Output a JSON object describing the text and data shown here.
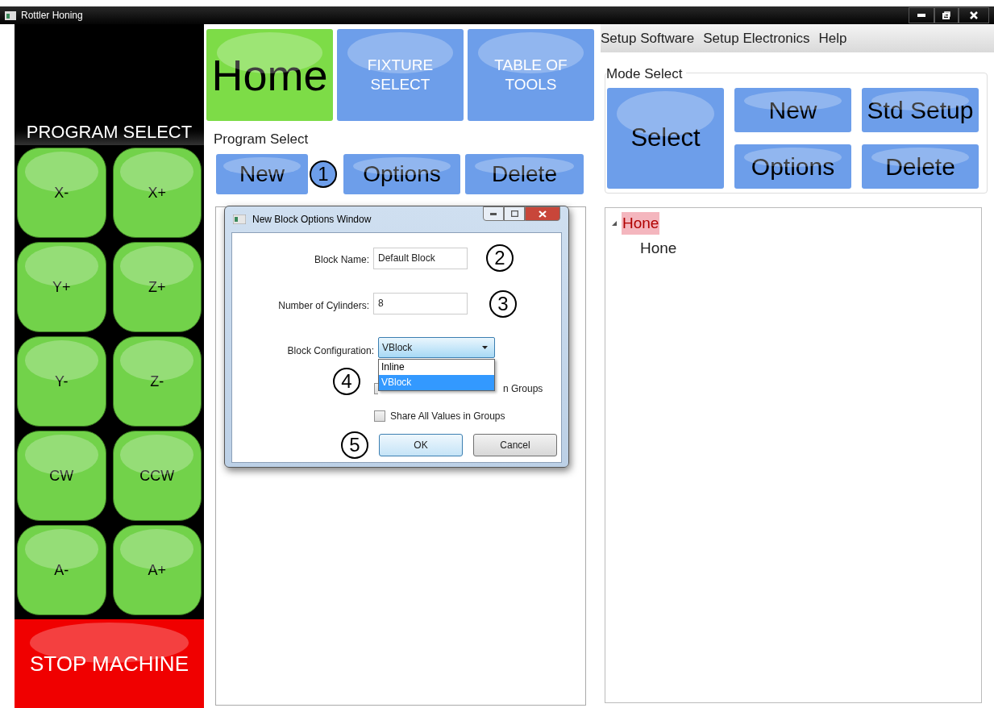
{
  "window": {
    "title": "Rottler Honing"
  },
  "left_panel": {
    "title": "PROGRAM SELECT",
    "jog_buttons": [
      "X-",
      "X+",
      "Y+",
      "Z+",
      "Y-",
      "Z-",
      "CW",
      "CCW",
      "A-",
      "A+"
    ],
    "stop_button": "STOP MACHINE"
  },
  "tabs": [
    {
      "label": "Home",
      "selected": true
    },
    {
      "label": "FIXTURE SELECT",
      "selected": false
    },
    {
      "label": "TABLE OF TOOLS",
      "selected": false
    }
  ],
  "program_select": {
    "label": "Program Select",
    "buttons": [
      {
        "label": "New",
        "callout": "1"
      },
      {
        "label": "Options"
      },
      {
        "label": "Delete"
      }
    ]
  },
  "dialog": {
    "title": "New Block Options Window",
    "block_name": {
      "label": "Block Name:",
      "value": "Default Block",
      "callout": "2"
    },
    "cylinders": {
      "label": "Number of Cylinders:",
      "value": "8",
      "callout": "3"
    },
    "block_configuration": {
      "label": "Block Configuration:",
      "value": "VBlock",
      "callout": "4",
      "options": [
        {
          "label": "Inline",
          "selected": false
        },
        {
          "label": "VBlock",
          "selected": true
        }
      ]
    },
    "checkboxes": [
      {
        "label": "n Groups",
        "checked": false
      },
      {
        "label": "Share All Values in Groups",
        "checked": false
      }
    ],
    "ok": "OK",
    "ok_callout": "5",
    "cancel": "Cancel"
  },
  "menu": [
    "Setup Software",
    "Setup Electronics",
    "Help"
  ],
  "mode_select": {
    "label": "Mode Select",
    "buttons": [
      "Select",
      "New",
      "Std Setup",
      "Options",
      "Delete"
    ]
  },
  "tree": [
    {
      "label": "Hone",
      "expanded": true,
      "selected": true,
      "children": [
        {
          "label": "Hone",
          "selected": false
        }
      ]
    }
  ]
}
